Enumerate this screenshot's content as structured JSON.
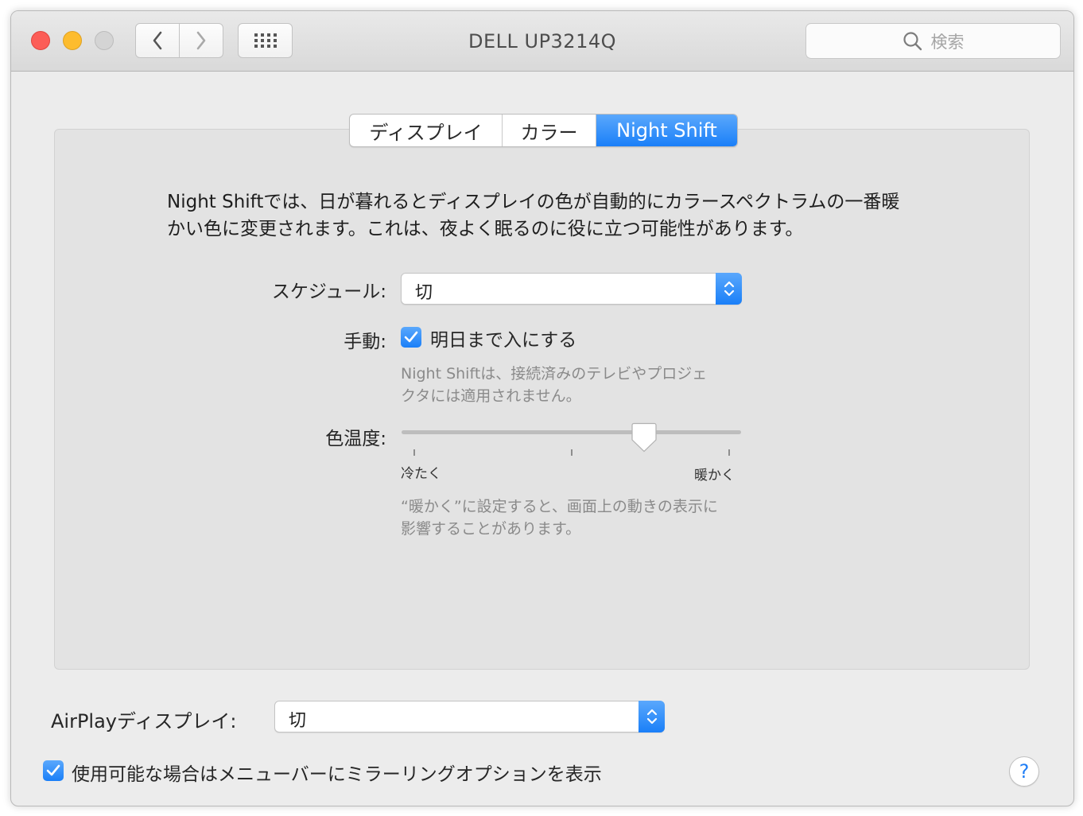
{
  "window": {
    "title": "DELL UP3214Q"
  },
  "toolbar": {
    "back_icon": "chevron-left-icon",
    "forward_icon": "chevron-right-icon",
    "grid_icon": "grid-icon"
  },
  "search": {
    "placeholder": "検索"
  },
  "tabs": [
    {
      "label": "ディスプレイ",
      "active": false
    },
    {
      "label": "カラー",
      "active": false
    },
    {
      "label": "Night Shift",
      "active": true
    }
  ],
  "description": {
    "line1": "Night Shiftでは、日が暮れるとディスプレイの色が自動的にカラースペクトラムの一番暖",
    "line2": "かい色に変更されます。これは、夜よく眠るのに役に立つ可能性があります。"
  },
  "schedule": {
    "label": "スケジュール:",
    "value": "切"
  },
  "manual": {
    "label": "手動:",
    "checkbox_label": "明日まで入にする",
    "checked": true,
    "note_line1": "Night Shiftは、接続済みのテレビやプロジェ",
    "note_line2": "クタには適用されません。"
  },
  "color_temperature": {
    "label": "色温度:",
    "min_label": "冷たく",
    "max_label": "暖かく",
    "value": 0.73,
    "note_line1": "“暖かく”に設定すると、画面上の動きの表示に",
    "note_line2": "影響することがあります。"
  },
  "airplay": {
    "label": "AirPlayディスプレイ:",
    "value": "切"
  },
  "mirroring": {
    "checked": true,
    "label": "使用可能な場合はメニューバーにミラーリングオプションを表示"
  },
  "help": {
    "label": "?"
  },
  "colors": {
    "accent": "#1a7ff8"
  }
}
